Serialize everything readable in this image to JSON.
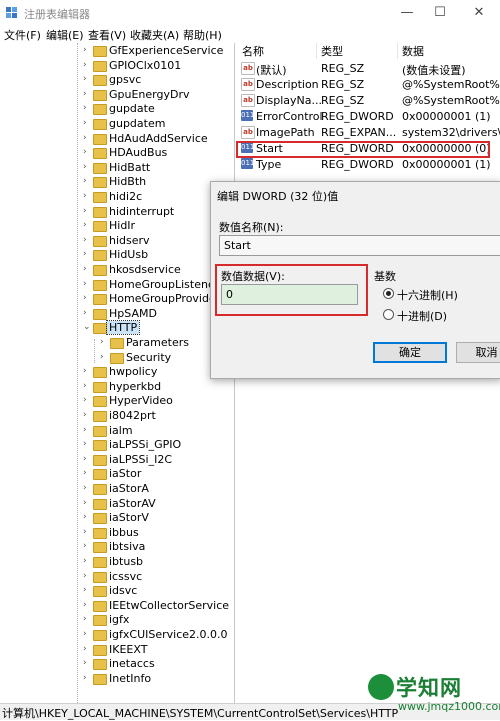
{
  "window": {
    "title": "注册表编辑器",
    "minimize": "—",
    "maximize": "☐",
    "close": "✕"
  },
  "menu": [
    "文件(F)",
    "编辑(E)",
    "查看(V)",
    "收藏夹(A)",
    "帮助(H)"
  ],
  "tree": [
    {
      "label": "GfExperienceService"
    },
    {
      "label": "GPIOClx0101"
    },
    {
      "label": "gpsvc"
    },
    {
      "label": "GpuEnergyDrv"
    },
    {
      "label": "gupdate"
    },
    {
      "label": "gupdatem"
    },
    {
      "label": "HdAudAddService"
    },
    {
      "label": "HDAudBus"
    },
    {
      "label": "HidBatt"
    },
    {
      "label": "HidBth"
    },
    {
      "label": "hidi2c"
    },
    {
      "label": "hidinterrupt"
    },
    {
      "label": "HidIr"
    },
    {
      "label": "hidserv"
    },
    {
      "label": "HidUsb"
    },
    {
      "label": "hkosdservice"
    },
    {
      "label": "HomeGroupListener"
    },
    {
      "label": "HomeGroupProvider"
    },
    {
      "label": "HpSAMD"
    },
    {
      "label": "HTTP",
      "selected": true,
      "expanded": true
    },
    {
      "label": "Parameters",
      "child": true
    },
    {
      "label": "Security",
      "child": true
    },
    {
      "label": "hwpolicy"
    },
    {
      "label": "hyperkbd"
    },
    {
      "label": "HyperVideo"
    },
    {
      "label": "i8042prt"
    },
    {
      "label": "ialm"
    },
    {
      "label": "iaLPSSi_GPIO"
    },
    {
      "label": "iaLPSSi_I2C"
    },
    {
      "label": "iaStor"
    },
    {
      "label": "iaStorA"
    },
    {
      "label": "iaStorAV"
    },
    {
      "label": "iaStorV"
    },
    {
      "label": "ibbus"
    },
    {
      "label": "ibtsiva"
    },
    {
      "label": "ibtusb"
    },
    {
      "label": "icssvc"
    },
    {
      "label": "idsvc"
    },
    {
      "label": "IEEtwCollectorService"
    },
    {
      "label": "igfx"
    },
    {
      "label": "igfxCUIService2.0.0.0"
    },
    {
      "label": "IKEEXT"
    },
    {
      "label": "inetaccs"
    },
    {
      "label": "InetInfo"
    }
  ],
  "columns": {
    "name": "名称",
    "type": "类型",
    "data": "数据"
  },
  "values": [
    {
      "name": "(默认)",
      "type": "REG_SZ",
      "data": "(数值未设置)",
      "icon": "string-value-icon"
    },
    {
      "name": "Description",
      "type": "REG_SZ",
      "data": "@%SystemRoot%\\s",
      "icon": "string-value-icon"
    },
    {
      "name": "DisplayNa...",
      "type": "REG_SZ",
      "data": "@%SystemRoot%\\s",
      "icon": "string-value-icon"
    },
    {
      "name": "ErrorControl",
      "type": "REG_DWORD",
      "data": "0x00000001 (1)",
      "icon": "dword-value-icon"
    },
    {
      "name": "ImagePath",
      "type": "REG_EXPAN...",
      "data": "system32\\drivers\\H",
      "icon": "string-value-icon"
    },
    {
      "name": "Start",
      "type": "REG_DWORD",
      "data": "0x00000000 (0)",
      "icon": "dword-value-icon"
    },
    {
      "name": "Type",
      "type": "REG_DWORD",
      "data": "0x00000001 (1)",
      "icon": "dword-value-icon"
    }
  ],
  "dialog": {
    "title": "编辑 DWORD (32 位)值",
    "name_label": "数值名称(N):",
    "name_value": "Start",
    "data_label": "数值数据(V):",
    "data_value": "0",
    "base_label": "基数",
    "hex_label": "十六进制(H)",
    "dec_label": "十进制(D)",
    "base_selected": "hex",
    "ok": "确定",
    "cancel": "取消"
  },
  "status": "计算机\\HKEY_LOCAL_MACHINE\\SYSTEM\\CurrentControlSet\\Services\\HTTP",
  "watermark": {
    "big": "学知网",
    "small": "www.jmqz1000.com"
  }
}
